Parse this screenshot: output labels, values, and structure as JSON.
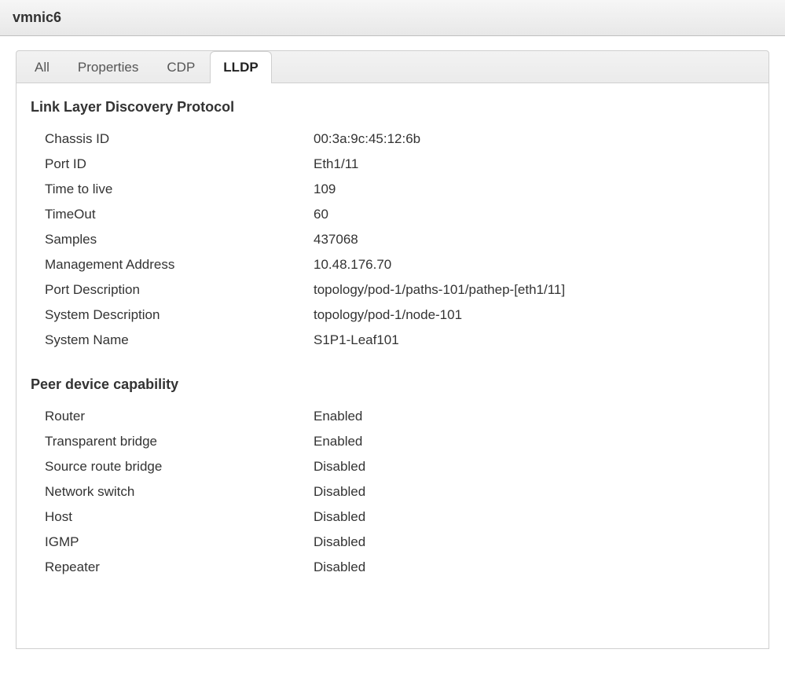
{
  "window": {
    "title": "vmnic6"
  },
  "tabs": [
    {
      "label": "All"
    },
    {
      "label": "Properties"
    },
    {
      "label": "CDP"
    },
    {
      "label": "LLDP"
    }
  ],
  "lldp": {
    "section_title": "Link Layer Discovery Protocol",
    "rows": {
      "chassis_id": {
        "label": "Chassis ID",
        "value": "00:3a:9c:45:12:6b"
      },
      "port_id": {
        "label": "Port ID",
        "value": "Eth1/11"
      },
      "ttl": {
        "label": "Time to live",
        "value": "109"
      },
      "timeout": {
        "label": "TimeOut",
        "value": "60"
      },
      "samples": {
        "label": "Samples",
        "value": "437068"
      },
      "mgmt_addr": {
        "label": "Management Address",
        "value": "10.48.176.70"
      },
      "port_desc": {
        "label": "Port Description",
        "value": "topology/pod-1/paths-101/pathep-[eth1/11]"
      },
      "sys_desc": {
        "label": "System Description",
        "value": "topology/pod-1/node-101"
      },
      "sys_name": {
        "label": "System Name",
        "value": "S1P1-Leaf101"
      }
    }
  },
  "peer_cap": {
    "section_title": "Peer device capability",
    "rows": {
      "router": {
        "label": "Router",
        "value": "Enabled"
      },
      "tbridge": {
        "label": "Transparent bridge",
        "value": "Enabled"
      },
      "srcroute": {
        "label": "Source route bridge",
        "value": "Disabled"
      },
      "netswitch": {
        "label": "Network switch",
        "value": "Disabled"
      },
      "host": {
        "label": "Host",
        "value": "Disabled"
      },
      "igmp": {
        "label": "IGMP",
        "value": "Disabled"
      },
      "repeater": {
        "label": "Repeater",
        "value": "Disabled"
      }
    }
  }
}
